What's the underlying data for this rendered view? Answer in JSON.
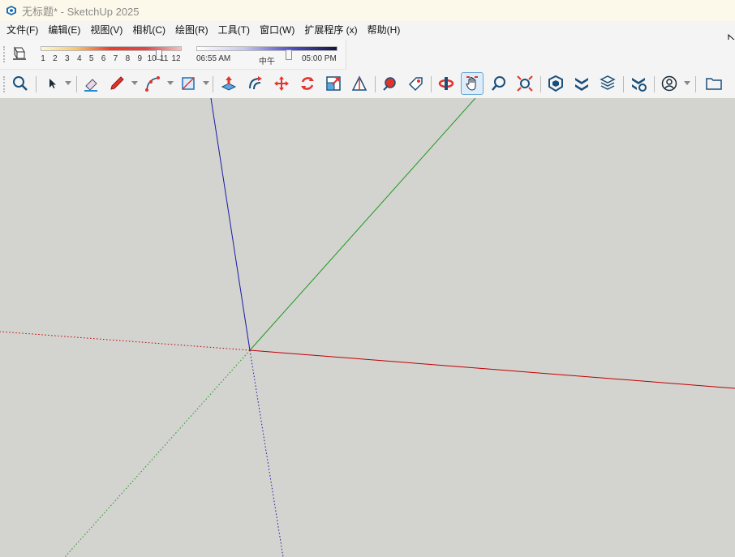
{
  "window": {
    "title": "无标题* - SketchUp 2025",
    "app_icon": "sketchup-logo-icon"
  },
  "menubar": {
    "items": [
      "文件(F)",
      "编辑(E)",
      "视图(V)",
      "相机(C)",
      "绘图(R)",
      "工具(T)",
      "窗口(W)",
      "扩展程序 (x)",
      "帮助(H)"
    ]
  },
  "shadows": {
    "icon": "shadows-toggle-icon",
    "month_ticks": [
      "1",
      "2",
      "3",
      "4",
      "5",
      "6",
      "7",
      "8",
      "9",
      "10",
      "11",
      "12"
    ],
    "month_slider_value": 0.84,
    "time_start": "06:55 AM",
    "time_mid": "中午",
    "time_end": "05:00 PM",
    "time_slider_value": 0.65
  },
  "toolbar": {
    "tools": [
      {
        "name": "search-tool-icon"
      },
      {
        "name": "select-tool-icon"
      },
      {
        "name": "eraser-tool-icon"
      },
      {
        "name": "line-tool-icon"
      },
      {
        "name": "arc-tool-icon"
      },
      {
        "name": "rectangle-tool-icon"
      },
      {
        "name": "push-pull-tool-icon"
      },
      {
        "name": "offset-tool-icon"
      },
      {
        "name": "move-tool-icon"
      },
      {
        "name": "rotate-tool-icon"
      },
      {
        "name": "scale-tool-icon"
      },
      {
        "name": "tape-measure-tool-icon"
      },
      {
        "name": "paint-bucket-tool-icon"
      },
      {
        "name": "tag-tool-icon"
      },
      {
        "name": "orbit-tool-icon"
      },
      {
        "name": "pan-tool-icon"
      },
      {
        "name": "zoom-tool-icon"
      },
      {
        "name": "zoom-extents-tool-icon"
      },
      {
        "name": "3d-warehouse-icon"
      },
      {
        "name": "extension-warehouse-icon"
      },
      {
        "name": "layout-send-icon"
      },
      {
        "name": "extension-manager-icon"
      },
      {
        "name": "account-icon"
      },
      {
        "name": "open-folder-icon"
      }
    ],
    "active_tool": "pan-tool-icon"
  },
  "colors": {
    "viewport_bg": "#d3d3cf",
    "axis_red": "#c00000",
    "axis_green": "#1e9a1e",
    "axis_blue": "#1a1aa8",
    "titlebar_bg": "#fdf9ea",
    "active_tool_bg": "#dcecf9"
  }
}
